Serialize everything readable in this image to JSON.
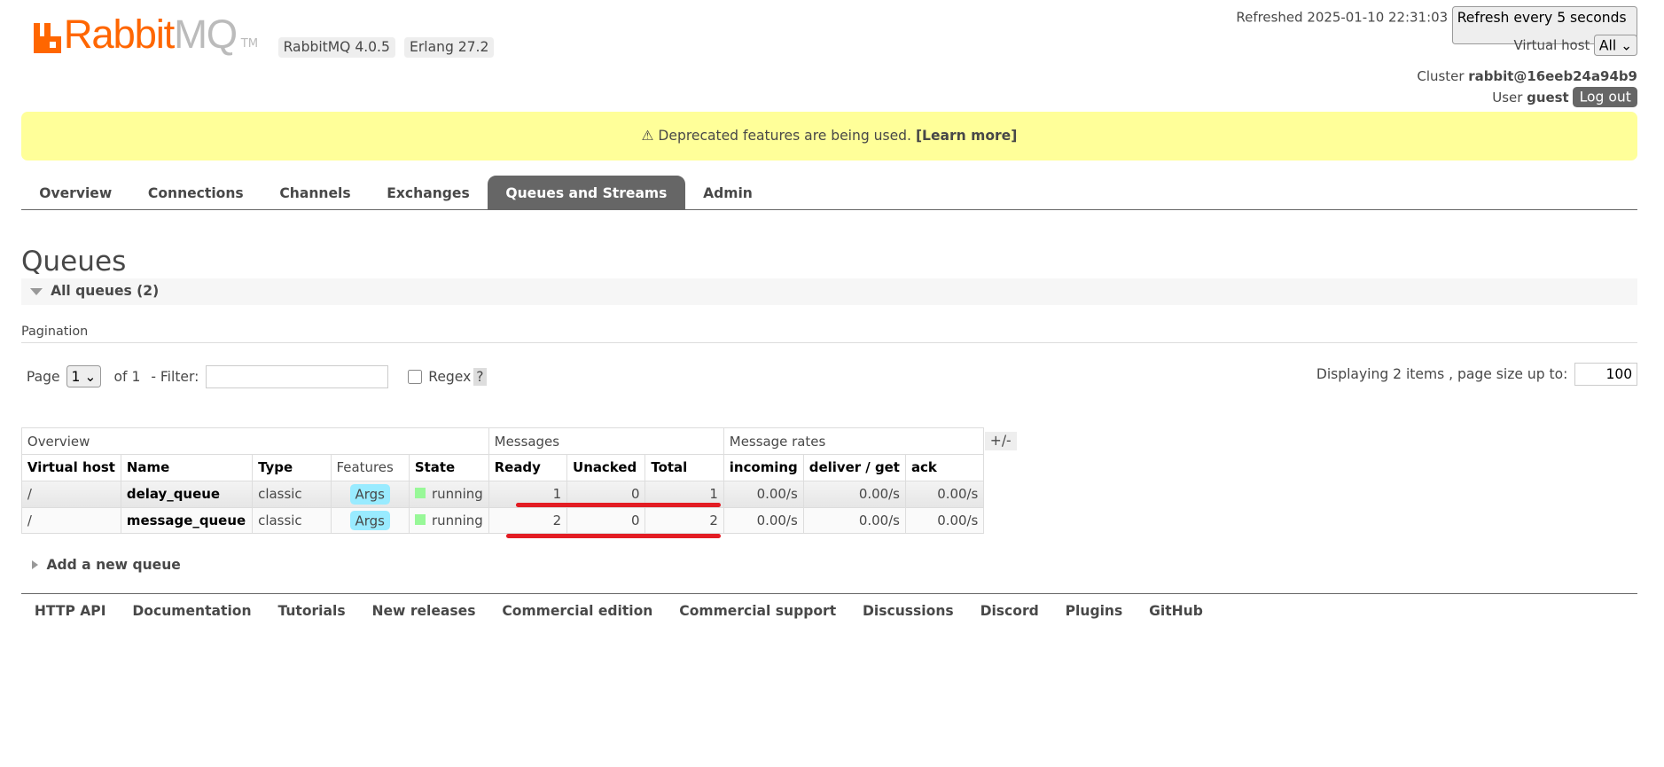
{
  "header": {
    "logo_text": "RabbitMQ",
    "logo_tm": "TM",
    "version_badge": "RabbitMQ 4.0.5",
    "erlang_badge": "Erlang 27.2",
    "refreshed_label": "Refreshed 2025-01-10 22:31:03",
    "refresh_select": "Refresh every 5 seconds",
    "vhost_label": "Virtual host",
    "vhost_select": "All",
    "cluster_label": "Cluster",
    "cluster_name": "rabbit@16eeb24a94b9",
    "user_label": "User",
    "user_name": "guest",
    "logout": "Log out"
  },
  "banner": {
    "icon": "warning-icon",
    "text": "⚠ Deprecated features are being used. ",
    "link": "[Learn more]"
  },
  "tabs": [
    {
      "label": "Overview"
    },
    {
      "label": "Connections"
    },
    {
      "label": "Channels"
    },
    {
      "label": "Exchanges"
    },
    {
      "label": "Queues and Streams",
      "active": true
    },
    {
      "label": "Admin"
    }
  ],
  "page_title": "Queues",
  "section_title": "All queues (2)",
  "pagination": {
    "label": "Pagination",
    "page_label": "Page",
    "page_value": "1",
    "of_label": "of 1",
    "filter_label": "- Filter:",
    "filter_value": "",
    "regex_label": "Regex",
    "help": "?",
    "displaying": "Displaying 2 items , page size up to:",
    "page_size": "100"
  },
  "table": {
    "groups": [
      "Overview",
      "Messages",
      "Message rates"
    ],
    "toggle": "+/-",
    "columns": [
      "Virtual host",
      "Name",
      "Type",
      "Features",
      "State",
      "Ready",
      "Unacked",
      "Total",
      "incoming",
      "deliver / get",
      "ack"
    ],
    "rows": [
      {
        "vhost": "/",
        "name": "delay_queue",
        "type": "classic",
        "features": "Args",
        "state": "running",
        "ready": "1",
        "unacked": "0",
        "total": "1",
        "incoming": "0.00/s",
        "deliver": "0.00/s",
        "ack": "0.00/s"
      },
      {
        "vhost": "/",
        "name": "message_queue",
        "type": "classic",
        "features": "Args",
        "state": "running",
        "ready": "2",
        "unacked": "0",
        "total": "2",
        "incoming": "0.00/s",
        "deliver": "0.00/s",
        "ack": "0.00/s"
      }
    ],
    "state_color": "#98f898",
    "annotation_color": "#e31c23"
  },
  "add_queue": "Add a new queue",
  "footer": [
    "HTTP API",
    "Documentation",
    "Tutorials",
    "New releases",
    "Commercial edition",
    "Commercial support",
    "Discussions",
    "Discord",
    "Plugins",
    "GitHub"
  ]
}
